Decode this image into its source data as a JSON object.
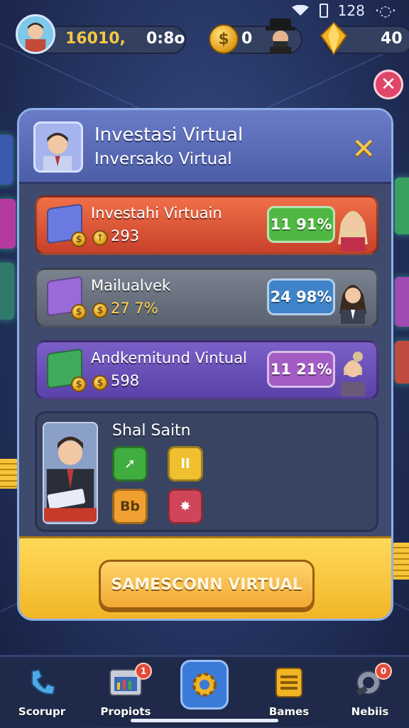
{
  "status_bar": {
    "time": "128"
  },
  "hud": {
    "currency_value": "16010,",
    "timer": "0:8o",
    "coins": "0",
    "gems": "40",
    "colors": {
      "gold": "#f1b424",
      "pill": "#33405f"
    }
  },
  "modal": {
    "title_line1": "Investasi Virtual",
    "title_line2": "Inversako Virtual",
    "rows": [
      {
        "title": "Investahi Virtuain",
        "value": "293",
        "badge": "11 91%",
        "color": "#e0583a",
        "badge_color": "#4fb843"
      },
      {
        "title": "Mailualvek",
        "value": "27 7%",
        "color": "#6a7280",
        "badge": "24 98%",
        "badge_color": "#3f84c8"
      },
      {
        "title": "Andkemitund Vintual",
        "value": "598",
        "badge": "11 21%",
        "color": "#6a4fb6",
        "badge_color": "#a35cc4"
      }
    ],
    "skills": {
      "title": "Shal Saitn",
      "buttons": [
        {
          "icon": "arrow-up-right-icon",
          "label": "",
          "color": "#3fae3f"
        },
        {
          "icon": "",
          "label": "ll",
          "color": "#f0c030"
        },
        {
          "icon": "",
          "label": "Bb",
          "color": "#f0a030"
        },
        {
          "icon": "star-icon",
          "label": "",
          "color": "#d0455a"
        }
      ]
    },
    "main_button": "SAMESCONN VIRTUAL"
  },
  "bottom_nav": [
    {
      "label": "Scorupr",
      "icon": "phone-icon",
      "badge": ""
    },
    {
      "label": "Propiots",
      "icon": "chart-window-icon",
      "badge": "1"
    },
    {
      "label": "",
      "icon": "gear-icon",
      "badge": ""
    },
    {
      "label": "Bames",
      "icon": "list-icon",
      "badge": ""
    },
    {
      "label": "Nebiis",
      "icon": "bell-icon",
      "badge": "0"
    }
  ]
}
